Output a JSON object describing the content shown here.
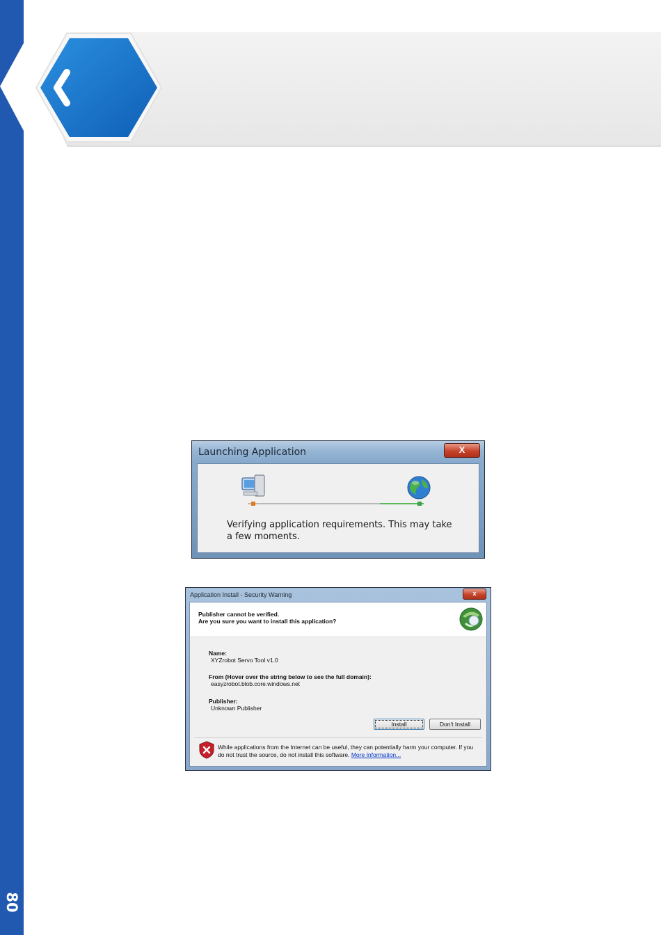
{
  "page": {
    "number": "80"
  },
  "header": {
    "back_icon": "chevron-left-icon",
    "colors": {
      "hexagon": "#1a78cf",
      "sidebar": "#2159b0",
      "banner": "#efefef"
    }
  },
  "launch_dialog": {
    "title": "Launching Application",
    "close_label": "X",
    "message": "Verifying application requirements. This may take a few moments.",
    "icons": [
      "computer-icon",
      "globe-icon"
    ]
  },
  "security_dialog": {
    "title": "Application Install - Security Warning",
    "close_label": "x",
    "heading_line1": "Publisher cannot be verified.",
    "heading_line2": "Are you sure you want to install this application?",
    "name_label": "Name:",
    "name_value": "XYZrobot Servo Tool v1.0",
    "from_label": "From (Hover over the string below to see the full domain):",
    "from_value": "easyzrobot.blob.core.windows.net",
    "publisher_label": "Publisher:",
    "publisher_value": "Unknown Publisher",
    "install_label": "Install",
    "dont_install_label": "Don't Install",
    "warning_text": "While applications from the Internet can be useful, they can potentially harm your computer. If you do not trust the source, do not install this software.",
    "more_info_label": "More Information...",
    "icons": [
      "clickonce-icon",
      "shield-warning-icon"
    ]
  }
}
